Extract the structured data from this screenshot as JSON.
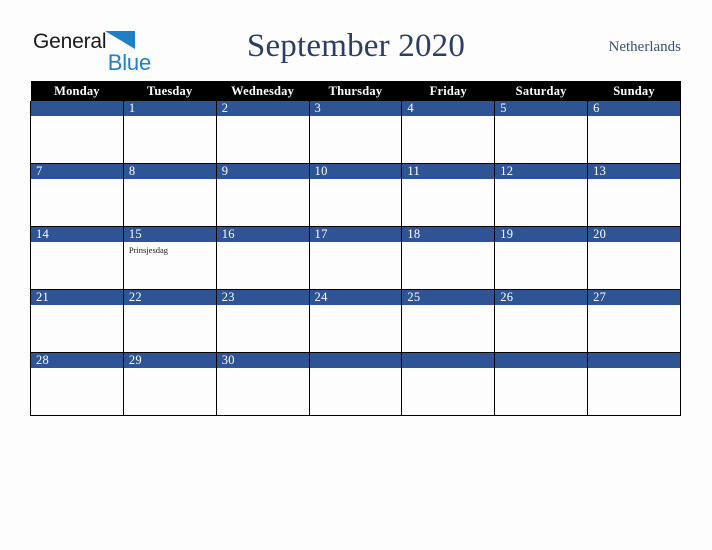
{
  "brand": {
    "name_part1": "General",
    "name_part2": "Blue",
    "triangle_color": "#1f7fc4",
    "text_color": "#1a1a1a"
  },
  "header": {
    "title": "September 2020",
    "country": "Netherlands",
    "title_color": "#2c3e66",
    "country_color": "#3b4f7d"
  },
  "calendar": {
    "month": "September",
    "year": "2020",
    "accent_color": "#2e5496",
    "header_bg": "#000000",
    "weekday_headers": [
      "Monday",
      "Tuesday",
      "Wednesday",
      "Thursday",
      "Friday",
      "Saturday",
      "Sunday"
    ],
    "weeks": [
      [
        {
          "day": "",
          "events": []
        },
        {
          "day": "1",
          "events": []
        },
        {
          "day": "2",
          "events": []
        },
        {
          "day": "3",
          "events": []
        },
        {
          "day": "4",
          "events": []
        },
        {
          "day": "5",
          "events": []
        },
        {
          "day": "6",
          "events": []
        }
      ],
      [
        {
          "day": "7",
          "events": []
        },
        {
          "day": "8",
          "events": []
        },
        {
          "day": "9",
          "events": []
        },
        {
          "day": "10",
          "events": []
        },
        {
          "day": "11",
          "events": []
        },
        {
          "day": "12",
          "events": []
        },
        {
          "day": "13",
          "events": []
        }
      ],
      [
        {
          "day": "14",
          "events": []
        },
        {
          "day": "15",
          "events": [
            "Prinsjesdag"
          ]
        },
        {
          "day": "16",
          "events": []
        },
        {
          "day": "17",
          "events": []
        },
        {
          "day": "18",
          "events": []
        },
        {
          "day": "19",
          "events": []
        },
        {
          "day": "20",
          "events": []
        }
      ],
      [
        {
          "day": "21",
          "events": []
        },
        {
          "day": "22",
          "events": []
        },
        {
          "day": "23",
          "events": []
        },
        {
          "day": "24",
          "events": []
        },
        {
          "day": "25",
          "events": []
        },
        {
          "day": "26",
          "events": []
        },
        {
          "day": "27",
          "events": []
        }
      ],
      [
        {
          "day": "28",
          "events": []
        },
        {
          "day": "29",
          "events": []
        },
        {
          "day": "30",
          "events": []
        },
        {
          "day": "",
          "events": []
        },
        {
          "day": "",
          "events": []
        },
        {
          "day": "",
          "events": []
        },
        {
          "day": "",
          "events": []
        }
      ]
    ]
  }
}
